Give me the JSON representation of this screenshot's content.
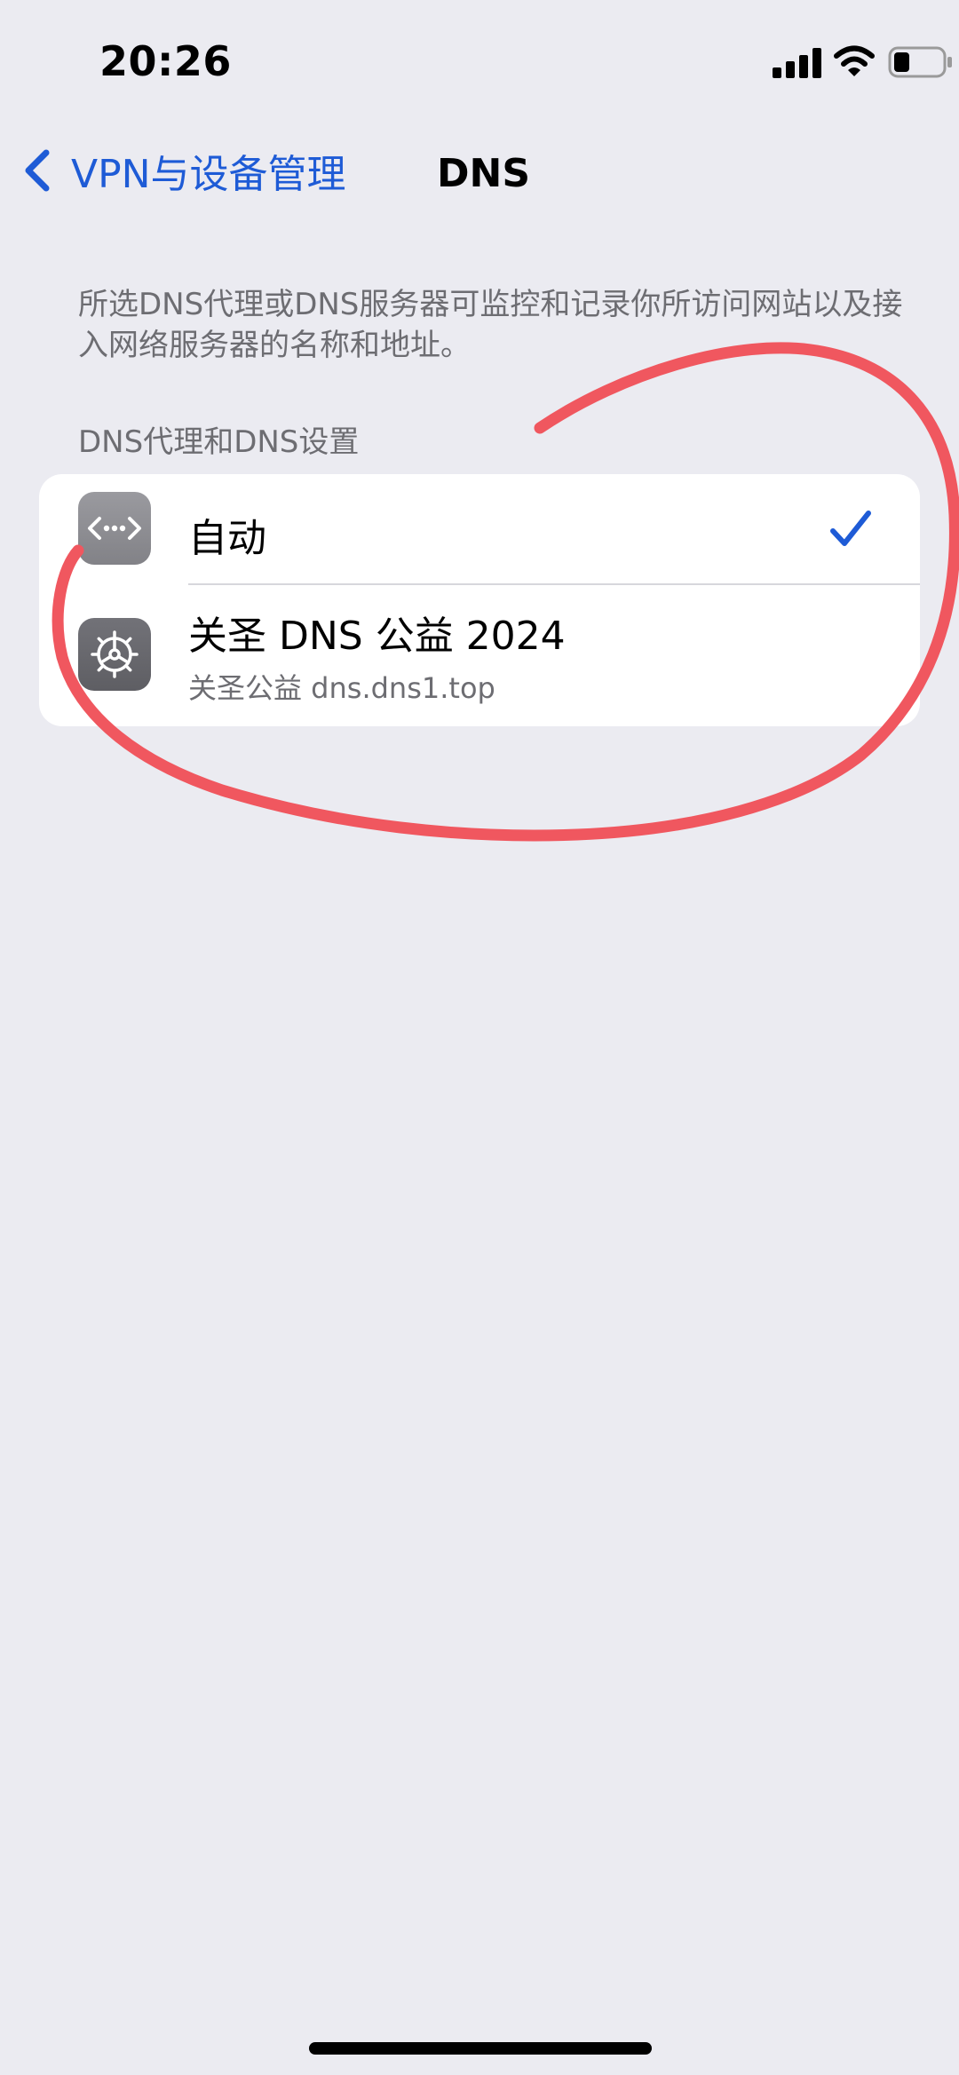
{
  "status_bar": {
    "time": "20:26",
    "icons": [
      "cellular-signal-icon",
      "wifi-icon",
      "battery-icon"
    ]
  },
  "nav": {
    "back_label": "VPN与设备管理",
    "title": "DNS"
  },
  "description": "所选DNS代理或DNS服务器可监控和记录你所访问网站以及接入网络服务器的名称和地址。",
  "section_header": "DNS代理和DNS设置",
  "options": [
    {
      "title": "自动",
      "subtitle": "",
      "icon": "automatic-network-icon",
      "selected": true
    },
    {
      "title": "关圣 DNS 公益 2024",
      "subtitle": "关圣公益 dns.dns1.top",
      "icon": "settings-gear-icon",
      "selected": false
    }
  ],
  "colors": {
    "accent": "#1E5BD6",
    "background": "#EBEBF1",
    "annotation": "#F0575F"
  }
}
